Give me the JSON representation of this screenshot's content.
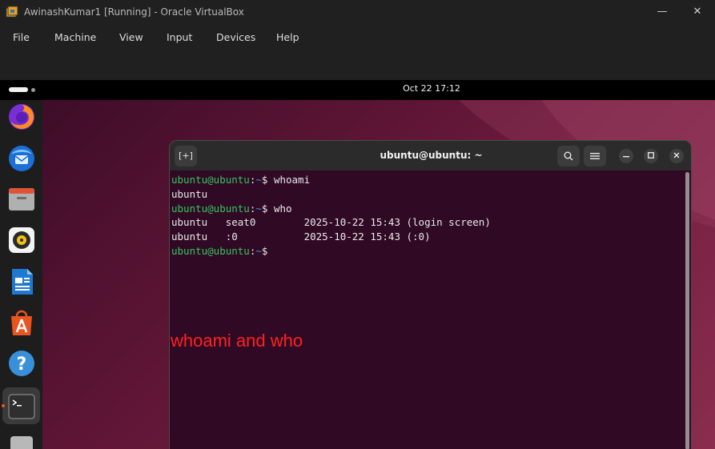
{
  "window": {
    "title": "AwinashKumar1 [Running] - Oracle VirtualBox",
    "controls": {
      "minimize": "—",
      "maximize": "☐",
      "close": "✕"
    }
  },
  "menubar": {
    "items": [
      "File",
      "Machine",
      "View",
      "Input",
      "Devices",
      "Help"
    ]
  },
  "topbar": {
    "clock": "Oct 22  17:12"
  },
  "dock": {
    "apps": [
      "firefox-icon",
      "thunderbird-icon",
      "files-icon",
      "rhythmbox-icon",
      "writer-icon",
      "app-center-icon",
      "help-icon",
      "terminal-icon",
      "trash-icon"
    ]
  },
  "terminal": {
    "title": "ubuntu@ubuntu: ~",
    "new_tab_label": "[+]",
    "lines": [
      {
        "user": "ubuntu@ubuntu",
        "sep": ":",
        "path": "~",
        "cmd": "$ whoami"
      },
      {
        "out": "ubuntu"
      },
      {
        "user": "ubuntu@ubuntu",
        "sep": ":",
        "path": "~",
        "cmd": "$ who"
      },
      {
        "out": "ubuntu   seat0        2025-10-22 15:43 (login screen)"
      },
      {
        "out": "ubuntu   :0           2025-10-22 15:43 (:0)"
      },
      {
        "user": "ubuntu@ubuntu",
        "sep": ":",
        "path": "~",
        "cmd": "$"
      }
    ]
  },
  "annotation": {
    "text": "whoami and who",
    "color": "#ff2020"
  }
}
